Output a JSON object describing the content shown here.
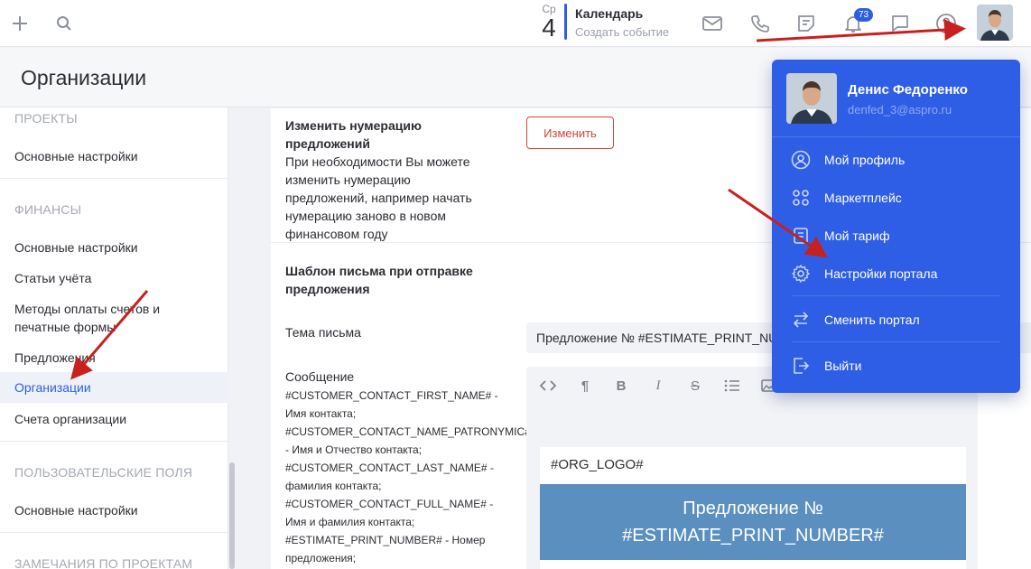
{
  "topbar": {
    "calendar": {
      "dow": "Ср",
      "day": "4",
      "title": "Календарь",
      "create": "Создать событие"
    },
    "notifications_count": "73",
    "icons": [
      "plus-icon",
      "search-icon",
      "mail-icon",
      "phone-icon",
      "notes-icon",
      "bell-icon",
      "chat-icon",
      "help-icon"
    ]
  },
  "page": {
    "title": "Организации"
  },
  "sidebar": {
    "s1": "ПРОЕКТЫ",
    "s1_item": "Основные настройки",
    "s2": "ФИНАНСЫ",
    "s2_items": [
      "Основные настройки",
      "Статьи учёта",
      "Методы оплаты счетов и печатные формы",
      "Предложения",
      "Организации",
      "Счета организации"
    ],
    "s3": "ПОЛЬЗОВАТЕЛЬСКИЕ ПОЛЯ",
    "s3_item": "Основные настройки",
    "s4": "ЗАМЕЧАНИЯ ПО ПРОЕКТАМ"
  },
  "main": {
    "numbering_title": "Изменить нумерацию предложений",
    "numbering_desc": "При необходимости Вы можете изменить нумерацию предложений, например начать нумерацию заново в новом финансовом году",
    "change_button": "Изменить",
    "template_title": "Шаблон письма при отправке предложения",
    "subject_label": "Тема письма",
    "subject_value": "Предложение № #ESTIMATE_PRINT_NUMBER#",
    "message_label": "Сообщение",
    "message_vars": [
      "#CUSTOMER_CONTACT_FIRST_NAME# -",
      "Имя контакта;",
      "#CUSTOMER_CONTACT_NAME_PATRONYMIC#",
      "- Имя и Отчество контакта;",
      "#CUSTOMER_CONTACT_LAST_NAME# -",
      "фамилия контакта;",
      "#CUSTOMER_CONTACT_FULL_NAME# -",
      "Имя и фамилия контакта;",
      "#ESTIMATE_PRINT_NUMBER# - Номер",
      "предложения;"
    ],
    "editor": {
      "logo_text": "#ORG_LOGO#",
      "banner_line1": "Предложение №",
      "banner_line2": "#ESTIMATE_PRINT_NUMBER#"
    }
  },
  "dropdown": {
    "name": "Денис Федоренко",
    "email": "denfed_3@aspro.ru",
    "items": [
      "Мой профиль",
      "Маркетплейс",
      "Мой тариф",
      "Настройки портала",
      "Сменить портал",
      "Выйти"
    ]
  },
  "colors": {
    "accent": "#2f5ee6",
    "danger": "#d9413a",
    "arrow": "#c8201f",
    "banner": "#5b8fbf"
  }
}
